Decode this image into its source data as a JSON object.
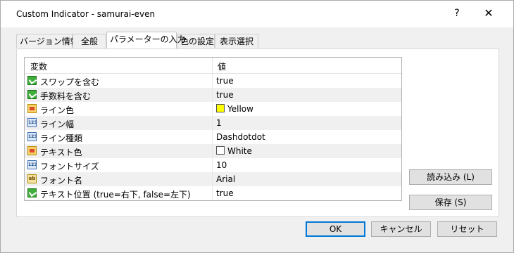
{
  "window": {
    "title": "Custom Indicator - samurai-even",
    "help_label": "?",
    "close_label": "✕"
  },
  "tabs": [
    {
      "label": "バージョン情報"
    },
    {
      "label": "全般"
    },
    {
      "label": "パラメーターの入力"
    },
    {
      "label": "色の設定"
    },
    {
      "label": "表示選択"
    }
  ],
  "grid": {
    "col_variable": "変数",
    "col_value": "値",
    "rows": [
      {
        "icon": "boolean-param-icon",
        "name": "スワップを含む",
        "value": "true"
      },
      {
        "icon": "boolean-param-icon",
        "name": "手数料を含む",
        "value": "true"
      },
      {
        "icon": "color-param-icon",
        "name": "ライン色",
        "value": "Yellow",
        "swatch": "#ffff00"
      },
      {
        "icon": "integer-param-icon",
        "name": "ライン幅",
        "value": "1"
      },
      {
        "icon": "integer-param-icon",
        "name": "ライン種類",
        "value": "Dashdotdot"
      },
      {
        "icon": "color-param-icon",
        "name": "テキスト色",
        "value": "White",
        "swatch": "#ffffff"
      },
      {
        "icon": "integer-param-icon",
        "name": "フォントサイズ",
        "value": "10"
      },
      {
        "icon": "string-param-icon",
        "name": "フォント名",
        "value": "Arial"
      },
      {
        "icon": "boolean-param-icon",
        "name": "テキスト位置 (true=右下, false=左下)",
        "value": "true"
      }
    ]
  },
  "buttons": {
    "load": "読み込み (L)",
    "save": "保存 (S)",
    "ok": "OK",
    "cancel": "キャンセル",
    "reset": "リセット"
  },
  "icon_text": {
    "int": "123",
    "str": "ab"
  }
}
